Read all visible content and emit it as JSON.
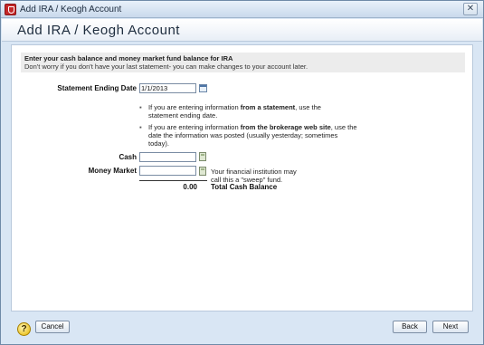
{
  "window": {
    "title": "Add IRA / Keogh Account",
    "close_glyph": "✕"
  },
  "header": {
    "title": "Add IRA / Keogh Account"
  },
  "info": {
    "heading": "Enter your cash balance and money market fund balance for IRA",
    "subtext": "Don't worry if you don't have your last statement- you can make changes to your account later."
  },
  "form": {
    "statement_date_label": "Statement Ending Date",
    "statement_date_value": "1/1/2013",
    "bullet1_pre": "If you are entering information ",
    "bullet1_bold": "from a statement",
    "bullet1_post": ", use the statement ending date.",
    "bullet2_pre": "If you are entering information ",
    "bullet2_bold": "from the brokerage web site",
    "bullet2_post": ", use the date the information was posted (usually yesterday; sometimes today).",
    "cash_label": "Cash",
    "cash_value": "",
    "money_market_label": "Money Market",
    "money_market_value": "",
    "money_market_note": "Your financial institution may call this a \"sweep\" fund.",
    "total_value": "0.00",
    "total_label": "Total Cash Balance"
  },
  "footer": {
    "help_glyph": "?",
    "cancel_label": "Cancel",
    "back_label": "Back",
    "next_label": "Next"
  },
  "icons": [
    "app-icon",
    "close-icon",
    "calendar-icon",
    "calculator-icon",
    "help-icon"
  ],
  "colors": {
    "title_bar": "#c9d9ec",
    "app_icon_red": "#c4282a",
    "help_yellow": "#e5b400"
  }
}
